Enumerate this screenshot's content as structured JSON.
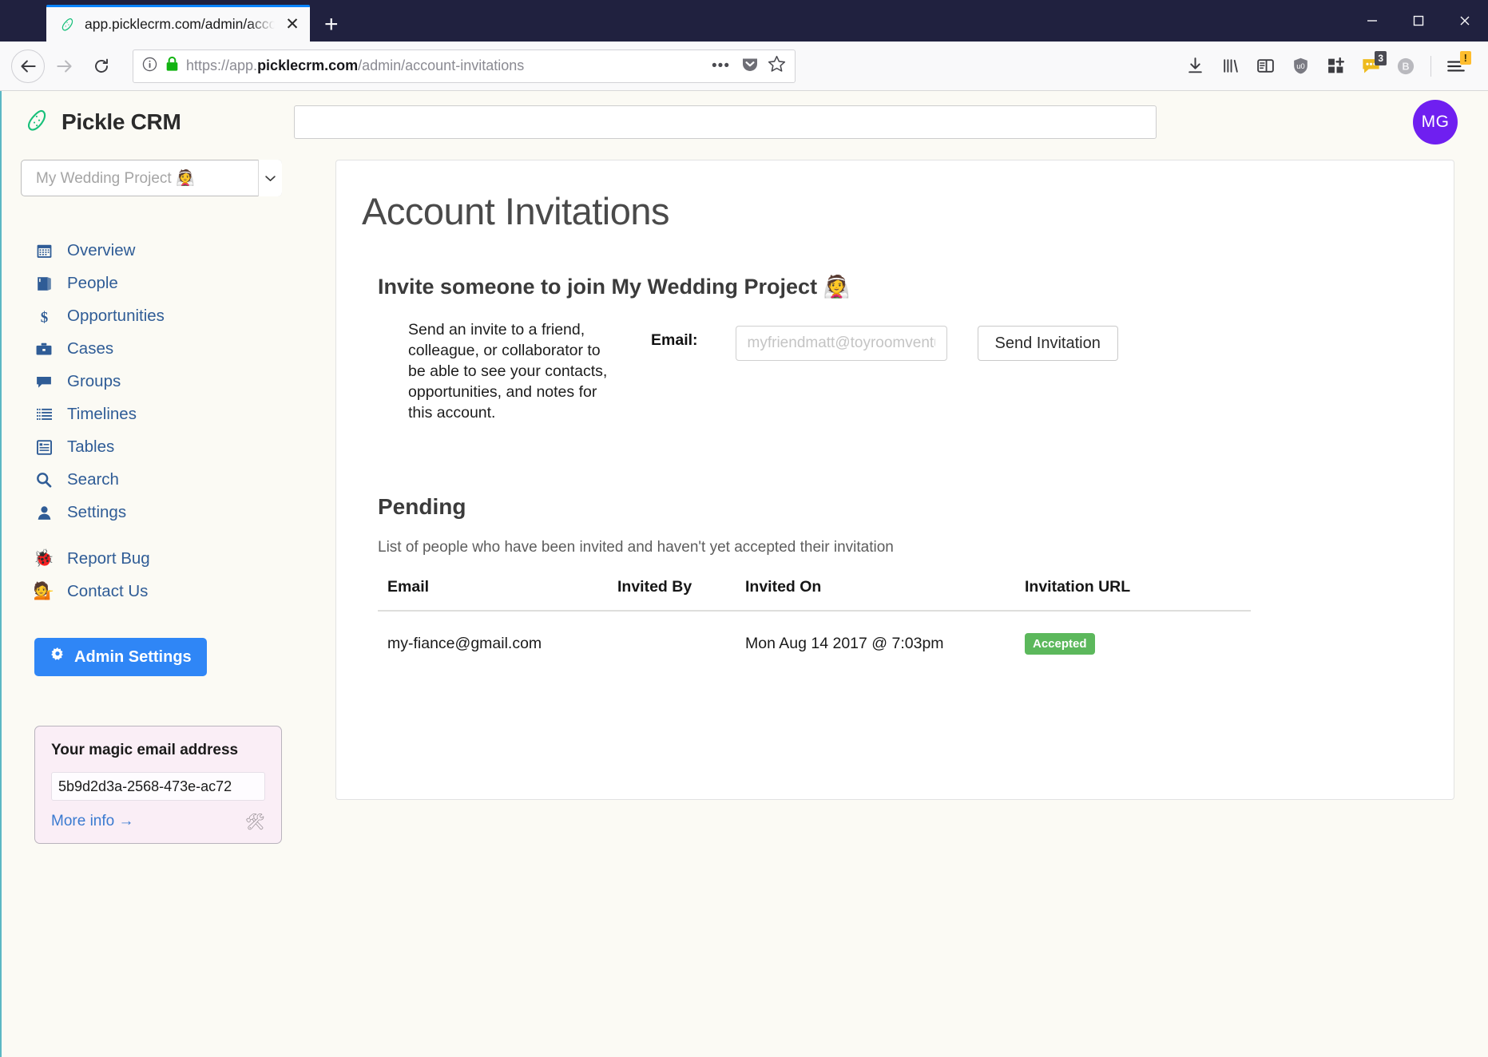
{
  "browser": {
    "tab": {
      "title": "app.picklecrm.com/admin/acco",
      "favicon": "pickle-icon",
      "close": "✕"
    },
    "newtab_label": "+",
    "window_controls": {
      "minimize": "minimize-icon",
      "maximize": "maximize-icon",
      "close": "close-icon"
    },
    "nav": {
      "back": "back-arrow-icon",
      "forward": "forward-arrow-icon",
      "reload": "reload-icon"
    },
    "url": {
      "info_icon": "info-icon",
      "lock_icon": "lock-icon",
      "scheme": "https://app.",
      "domain": "picklecrm.com",
      "path": "/admin/account-invitations",
      "page_actions": "•••",
      "pocket_icon": "pocket-icon",
      "bookmark_icon": "star-icon"
    },
    "toolbar_icons": [
      {
        "name": "downloads-icon"
      },
      {
        "name": "library-icon"
      },
      {
        "name": "sidebar-icon"
      },
      {
        "name": "ublock-origin-icon"
      },
      {
        "name": "extension-add-icon"
      },
      {
        "name": "messages-extension-icon",
        "badge": "3"
      },
      {
        "name": "bitwarden-icon",
        "letter": "B"
      },
      {
        "name": "hamburger-menu-icon",
        "badge": "!"
      }
    ]
  },
  "app": {
    "brand": {
      "logo": "pickle-logo",
      "name": "Pickle CRM"
    },
    "search": {
      "value": "",
      "placeholder": ""
    },
    "avatar": {
      "initials": "MG"
    }
  },
  "sidebar": {
    "project_selector": {
      "value": "My Wedding Project 👰",
      "chevron": "chevron-down-icon"
    },
    "items": [
      {
        "label": "Overview",
        "icon": "calendar-icon"
      },
      {
        "label": "People",
        "icon": "book-icon"
      },
      {
        "label": "Opportunities",
        "icon": "dollar-icon"
      },
      {
        "label": "Cases",
        "icon": "briefcase-icon"
      },
      {
        "label": "Groups",
        "icon": "comment-icon"
      },
      {
        "label": "Timelines",
        "icon": "list-icon"
      },
      {
        "label": "Tables",
        "icon": "table-icon"
      },
      {
        "label": "Search",
        "icon": "search-icon"
      },
      {
        "label": "Settings",
        "icon": "user-icon"
      }
    ],
    "secondary_items": [
      {
        "label": "Report Bug",
        "icon": "🐞"
      },
      {
        "label": "Contact Us",
        "icon": "💁"
      }
    ],
    "admin_button": {
      "label": "Admin Settings",
      "icon": "gear-icon"
    },
    "magic_email": {
      "title": "Your magic email address",
      "value": "5b9d2d3a-2568-473e-ac72",
      "more_link": "More info →",
      "tools_icon": "🛠"
    }
  },
  "main": {
    "page_title": "Account Invitations",
    "invite": {
      "heading": "Invite someone to join My Wedding Project 👰",
      "description": "Send an invite to a friend, colleague, or collaborator to be able to see your contacts, opportunities, and notes for this account.",
      "email_label": "Email:",
      "email_value": "",
      "email_placeholder": "myfriendmatt@toyroomventur",
      "send_label": "Send Invitation"
    },
    "pending": {
      "title": "Pending",
      "subtitle": "List of people who have been invited and haven't yet accepted their invitation",
      "columns": [
        "Email",
        "Invited By",
        "Invited On",
        "Invitation URL"
      ],
      "rows": [
        {
          "email": "my-fiance@gmail.com",
          "invited_by": "",
          "invited_on": "Mon Aug 14 2017 @ 7:03pm",
          "status": "Accepted"
        }
      ]
    }
  },
  "colors": {
    "chrome_dark": "#20213f",
    "accent_blue": "#2f86f6",
    "nav_link": "#2f5c96",
    "avatar_purple": "#6f1ff0",
    "status_green": "#5cb85c",
    "magic_box_bg": "#faeef6",
    "page_bg": "#fbfaf4"
  }
}
